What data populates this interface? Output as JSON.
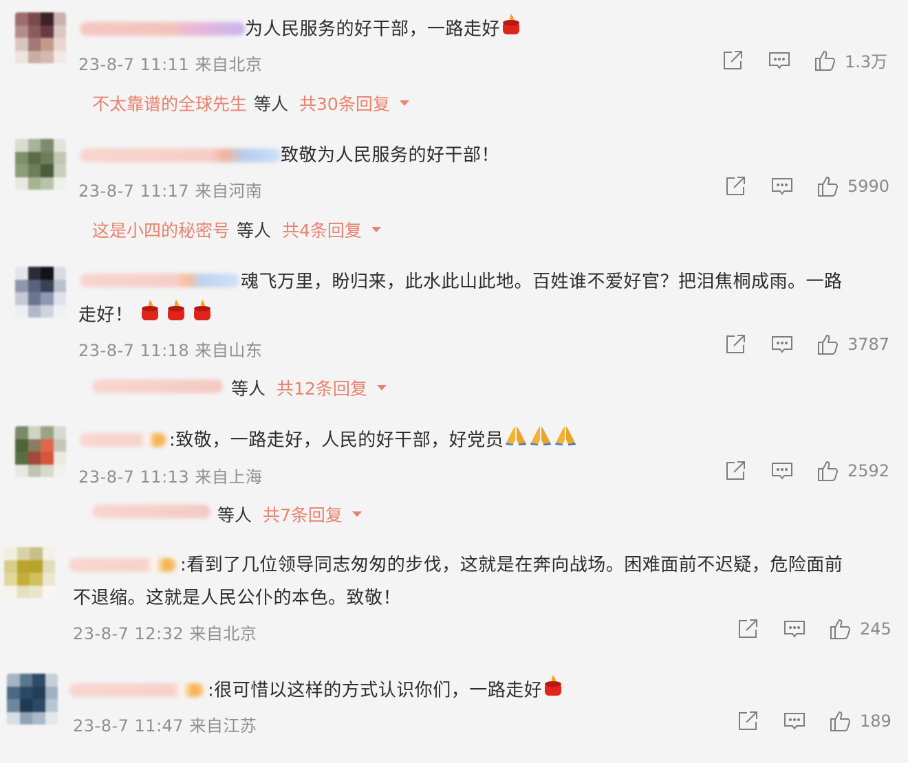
{
  "comments": [
    {
      "text": "为人民服务的好干部，一路走好",
      "emoji_after": [
        "candle-icon"
      ],
      "time": "23-8-7 11:11",
      "location": "来自北京",
      "likes": "1.3万",
      "reply": {
        "user": "不太靠谱的全球先生",
        "mid": "等人",
        "total": "共30条回复"
      }
    },
    {
      "text": "致敬为人民服务的好干部！",
      "time": "23-8-7 11:17",
      "location": "来自河南",
      "likes": "5990",
      "reply": {
        "user": "这是小四的秘密号",
        "mid": "等人",
        "total": "共4条回复"
      }
    },
    {
      "text": "魂飞万里，盼归来，此水此山此地。百姓谁不爱好官？把泪焦桐成雨。一路",
      "text2": "走好！",
      "emoji_after": [
        "candle-icon",
        "candle-icon",
        "candle-icon"
      ],
      "time": "23-8-7 11:18",
      "location": "来自山东",
      "likes": "3787",
      "reply": {
        "user": "",
        "mid": "等人",
        "total": "共12条回复"
      }
    },
    {
      "text": ":致敬，一路走好，人民的好干部，好党员",
      "emoji_after": [
        "pray-icon",
        "pray-icon",
        "pray-icon"
      ],
      "time": "23-8-7 11:13",
      "location": "来自上海",
      "likes": "2592",
      "reply": {
        "user": "",
        "mid": "等人",
        "total": "共7条回复"
      }
    },
    {
      "text": ":看到了几位领导同志匆匆的步伐，这就是在奔向战场。困难面前不迟疑，危险面前",
      "text2": "不退缩。这就是人民公仆的本色。致敬！",
      "time": "23-8-7 12:32",
      "location": "来自北京",
      "likes": "245"
    },
    {
      "text": ":很可惜以这样的方式认识你们，一路走好",
      "emoji_after": [
        "candle-icon"
      ],
      "time": "23-8-7 11:47",
      "location": "来自江苏",
      "likes": "189"
    }
  ],
  "icons": {
    "share": "share-icon",
    "comment": "comment-icon",
    "like": "like-icon"
  },
  "colors": {
    "accent": "#e8826f",
    "meta": "#8f8f8f",
    "background": "#f4f4f4"
  }
}
